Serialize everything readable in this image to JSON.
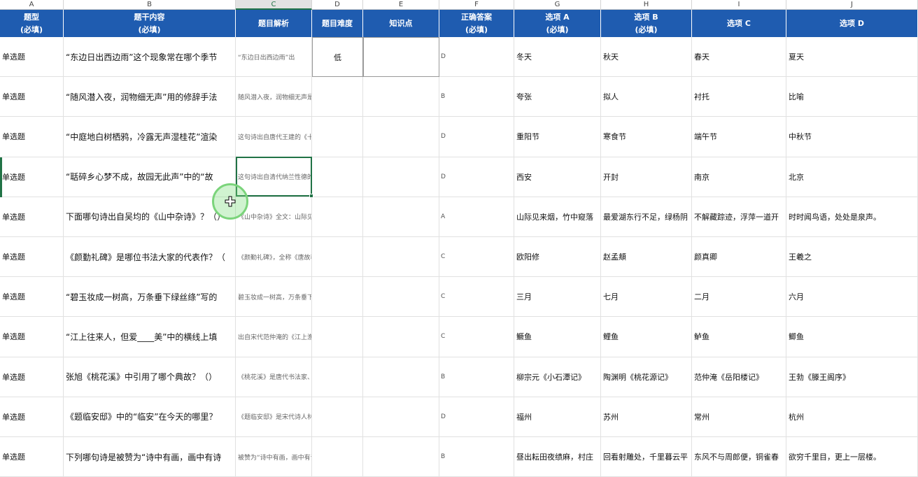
{
  "column_letters": [
    "A",
    "B",
    "C",
    "D",
    "E",
    "F",
    "G",
    "H",
    "I",
    "J"
  ],
  "active_column": "C",
  "headers": [
    {
      "line1": "题型",
      "line2": "(必填)"
    },
    {
      "line1": "题干内容",
      "line2": "(必填)"
    },
    {
      "line1": "题目解析",
      "line2": ""
    },
    {
      "line1": "题目难度",
      "line2": ""
    },
    {
      "line1": "知识点",
      "line2": ""
    },
    {
      "line1": "正确答案",
      "line2": "(必填)"
    },
    {
      "line1": "选项 A",
      "line2": "(必填)"
    },
    {
      "line1": "选项 B",
      "line2": "(必填)"
    },
    {
      "line1": "选项 C",
      "line2": ""
    },
    {
      "line1": "选项 D",
      "line2": ""
    }
  ],
  "rows": [
    {
      "type": "单选题",
      "question": "“东边日出西边雨”这个现象常在哪个季节",
      "explanation": "“东边日出西边雨”出",
      "difficulty": "低",
      "knowledge": "",
      "answer": "D",
      "a": "冬天",
      "b": "秋天",
      "c": "春天",
      "d": "夏天"
    },
    {
      "type": "单选题",
      "question": "“随风潜入夜，润物细无声”用的修辞手法",
      "explanation": "随风潜入夜，润物细无声是拟人的修辞手法，拟人是指把非人类",
      "difficulty": "",
      "knowledge": "",
      "answer": "B",
      "a": "夸张",
      "b": "拟人",
      "c": "衬托",
      "d": "比喻"
    },
    {
      "type": "单选题",
      "question": "“中庭地白树栖鸦，冷露无声湿桂花”渲染",
      "explanation": "这句诗出自唐代王建的《十五夜望月》，【译文】庭院地面雪白",
      "difficulty": "",
      "knowledge": "",
      "answer": "D",
      "a": "重阳节",
      "b": "寒食节",
      "c": "端午节",
      "d": "中秋节"
    },
    {
      "type": "单选题",
      "question": "“聒碎乡心梦不成，故园无此声”中的“故",
      "explanation": "这句诗出自清代纳兰性德的《长相思》，聒:声音嘈杂,这里指风",
      "difficulty": "",
      "knowledge": "",
      "answer": "D",
      "a": "西安",
      "b": "开封",
      "c": "南京",
      "d": "北京"
    },
    {
      "type": "单选题",
      "question": "下面哪句诗出自吴均的《山中杂诗》？（）",
      "explanation": "《山中杂诗》全文：山际见来烟，竹中窥落日。鸟向檐上飞，云",
      "difficulty": "",
      "knowledge": "",
      "answer": "A",
      "a": "山际见来烟，竹中窥落",
      "b": "最爱湖东行不足，绿杨阴",
      "c": "不解藏踪迹，浮萍一道开",
      "d": "时时闻鸟语，处处是泉声。"
    },
    {
      "type": "单选题",
      "question": "《颜勤礼碑》是哪位书法大家的代表作？（",
      "explanation": "《颜勤礼碑》，全称《唐故秘书省著作郎夔州都督府长史护军颜",
      "difficulty": "",
      "knowledge": "",
      "answer": "C",
      "a": "欧阳修",
      "b": "赵孟頫",
      "c": "颜真卿",
      "d": "王羲之"
    },
    {
      "type": "单选题",
      "question": "“碧玉妆成一树高，万条垂下绿丝绦”写的",
      "explanation": "碧玉妆成一树高，万条垂下绿丝绦。出自唐代贺知章的《咏柳 /",
      "difficulty": "",
      "knowledge": "",
      "answer": "C",
      "a": "三月",
      "b": "七月",
      "c": "二月",
      "d": "六月"
    },
    {
      "type": "单选题",
      "question": "“江上往来人，但爱____美”中的横线上填",
      "explanation": "出自宋代范仲淹的《江上渔者》：江上往来人,但爱鲈鱼美。君看",
      "difficulty": "",
      "knowledge": "",
      "answer": "C",
      "a": "鳜鱼",
      "b": "鲤鱼",
      "c": "鲈鱼",
      "d": "鲫鱼"
    },
    {
      "type": "单选题",
      "question": "张旭《桃花溪》中引用了哪个典故？（）",
      "explanation": "《桃花溪》是唐代书法家、诗人张旭创作的一首写景诗。此诗通",
      "difficulty": "",
      "knowledge": "",
      "answer": "B",
      "a": "柳宗元《小石潭记》",
      "b": "陶渊明《桃花源记》",
      "c": "范仲淹《岳阳楼记》",
      "d": "王勃《滕王阁序》"
    },
    {
      "type": "单选题",
      "question": "《题临安邸》中的“临安”在今天的哪里？",
      "explanation": "《题临安邸》是宋代诗人林升创作的一首七绝。此诗第一句点出",
      "difficulty": "",
      "knowledge": "",
      "answer": "D",
      "a": "福州",
      "b": "苏州",
      "c": "常州",
      "d": "杭州"
    },
    {
      "type": "单选题",
      "question": "下列哪句诗是被赞为“诗中有画，画中有诗",
      "explanation": "被赞为“诗中有画，画中有诗”的诗人是王维。B回看射雕处,千",
      "difficulty": "",
      "knowledge": "",
      "answer": "B",
      "a": "昼出耘田夜绩麻，村庄",
      "b": "回看射雕处，千里暮云平",
      "c": "东风不与周郎便，铜雀春",
      "d": "欲穷千里目，更上一层楼。"
    }
  ]
}
